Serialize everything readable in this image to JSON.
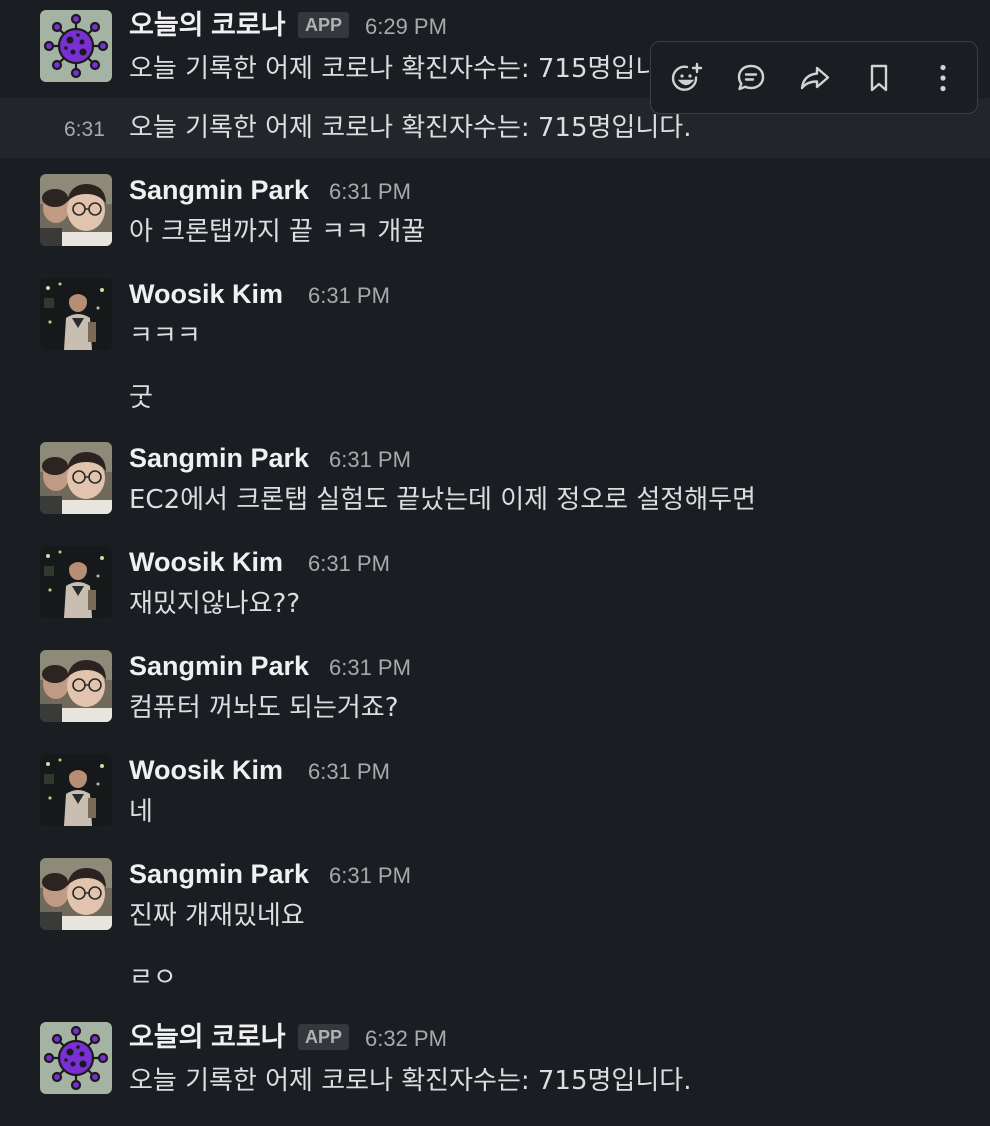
{
  "messages": [
    {
      "author": "오늘의 코로나",
      "badge": "APP",
      "time": "6:29 PM",
      "text": "오늘 기록한 어제 코로나 확진자수는: 715명입니다.",
      "avatar": "corona-bot"
    },
    {
      "continuation_time": "6:31",
      "text": "오늘 기록한 어제 코로나 확진자수는: 715명입니다."
    },
    {
      "author": "Sangmin Park",
      "time": "6:31 PM",
      "text": "아 크론탭까지 끝 ㅋㅋ 개꿀"
    },
    {
      "author": "Woosik Kim",
      "time": "6:31 PM",
      "text": "ㅋㅋㅋ",
      "text2": "굿"
    },
    {
      "author": "Sangmin Park",
      "time": "6:31 PM",
      "text": "EC2에서  크론탭 실험도 끝났는데 이제 정오로 설정해두면"
    },
    {
      "author": "Woosik Kim",
      "time": "6:31 PM",
      "text": "재밌지않나요??"
    },
    {
      "author": "Sangmin Park",
      "time": "6:31 PM",
      "text": "컴퓨터 꺼놔도 되는거죠?"
    },
    {
      "author": "Woosik Kim",
      "time": "6:31 PM",
      "text": "네"
    },
    {
      "author": "Sangmin Park",
      "time": "6:31 PM",
      "text": "진짜 개재밌네요",
      "text2": "ㄹㅇ"
    },
    {
      "author": "오늘의 코로나",
      "badge": "APP",
      "time": "6:32 PM",
      "text": "오늘 기록한 어제 코로나 확진자수는: 715명입니다."
    }
  ],
  "toolbar": {
    "icons": [
      "add-reaction-icon",
      "reply-thread-icon",
      "share-icon",
      "bookmark-icon",
      "more-actions-icon"
    ]
  },
  "colors": {
    "background": "#1a1d21",
    "hover_row": "#222529",
    "bot_avatar_bg": "#a5b3a4",
    "virus_purple": "#7a2fd4"
  }
}
